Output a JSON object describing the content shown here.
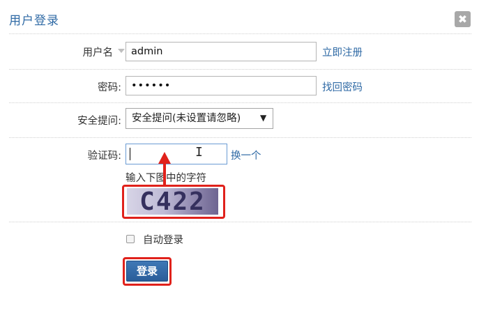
{
  "dialog": {
    "title": "用户登录",
    "close_label": "✖"
  },
  "form": {
    "username": {
      "label": "用户名",
      "value": "admin",
      "link": "立即注册"
    },
    "password": {
      "label": "密码:",
      "value": "••••••",
      "link": "找回密码"
    },
    "security_question": {
      "label": "安全提问:",
      "selected": "安全提问(未设置请忽略)"
    },
    "captcha": {
      "label": "验证码:",
      "value": "",
      "refresh_link": "换一个",
      "hint": "输入下图中的字符",
      "image_text": "C422"
    },
    "auto_login": {
      "label": "自动登录",
      "checked": false
    },
    "submit_label": "登录"
  },
  "colors": {
    "accent": "#2f6aa5",
    "highlight": "#e0211b",
    "button": "#2f67a6"
  },
  "icons": [
    "close-icon",
    "dropdown-caret-icon",
    "select-arrow-icon",
    "text-cursor-icon",
    "red-arrow-annotation"
  ]
}
